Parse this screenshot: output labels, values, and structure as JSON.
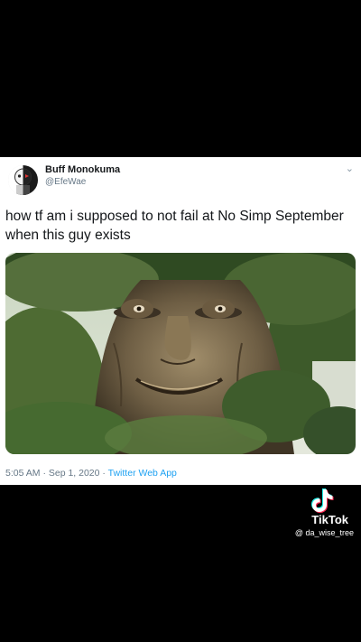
{
  "tweet": {
    "display_name": "Buff Monokuma",
    "handle": "@EfeWae",
    "text": "how tf am i supposed to not fail at No Simp September when this guy exists",
    "timestamp": "5:05 AM · Sep 1, 2020 · ",
    "source": "Twitter Web App"
  },
  "overlay": {
    "brand": "TikTok",
    "user": "@ da_wise_tree"
  },
  "icons": {
    "menu": "chevron-down-icon",
    "logo": "tiktok-logo-icon"
  },
  "colors": {
    "background": "#000000",
    "card": "#ffffff",
    "link": "#1da1f2",
    "secondary": "#657786"
  }
}
